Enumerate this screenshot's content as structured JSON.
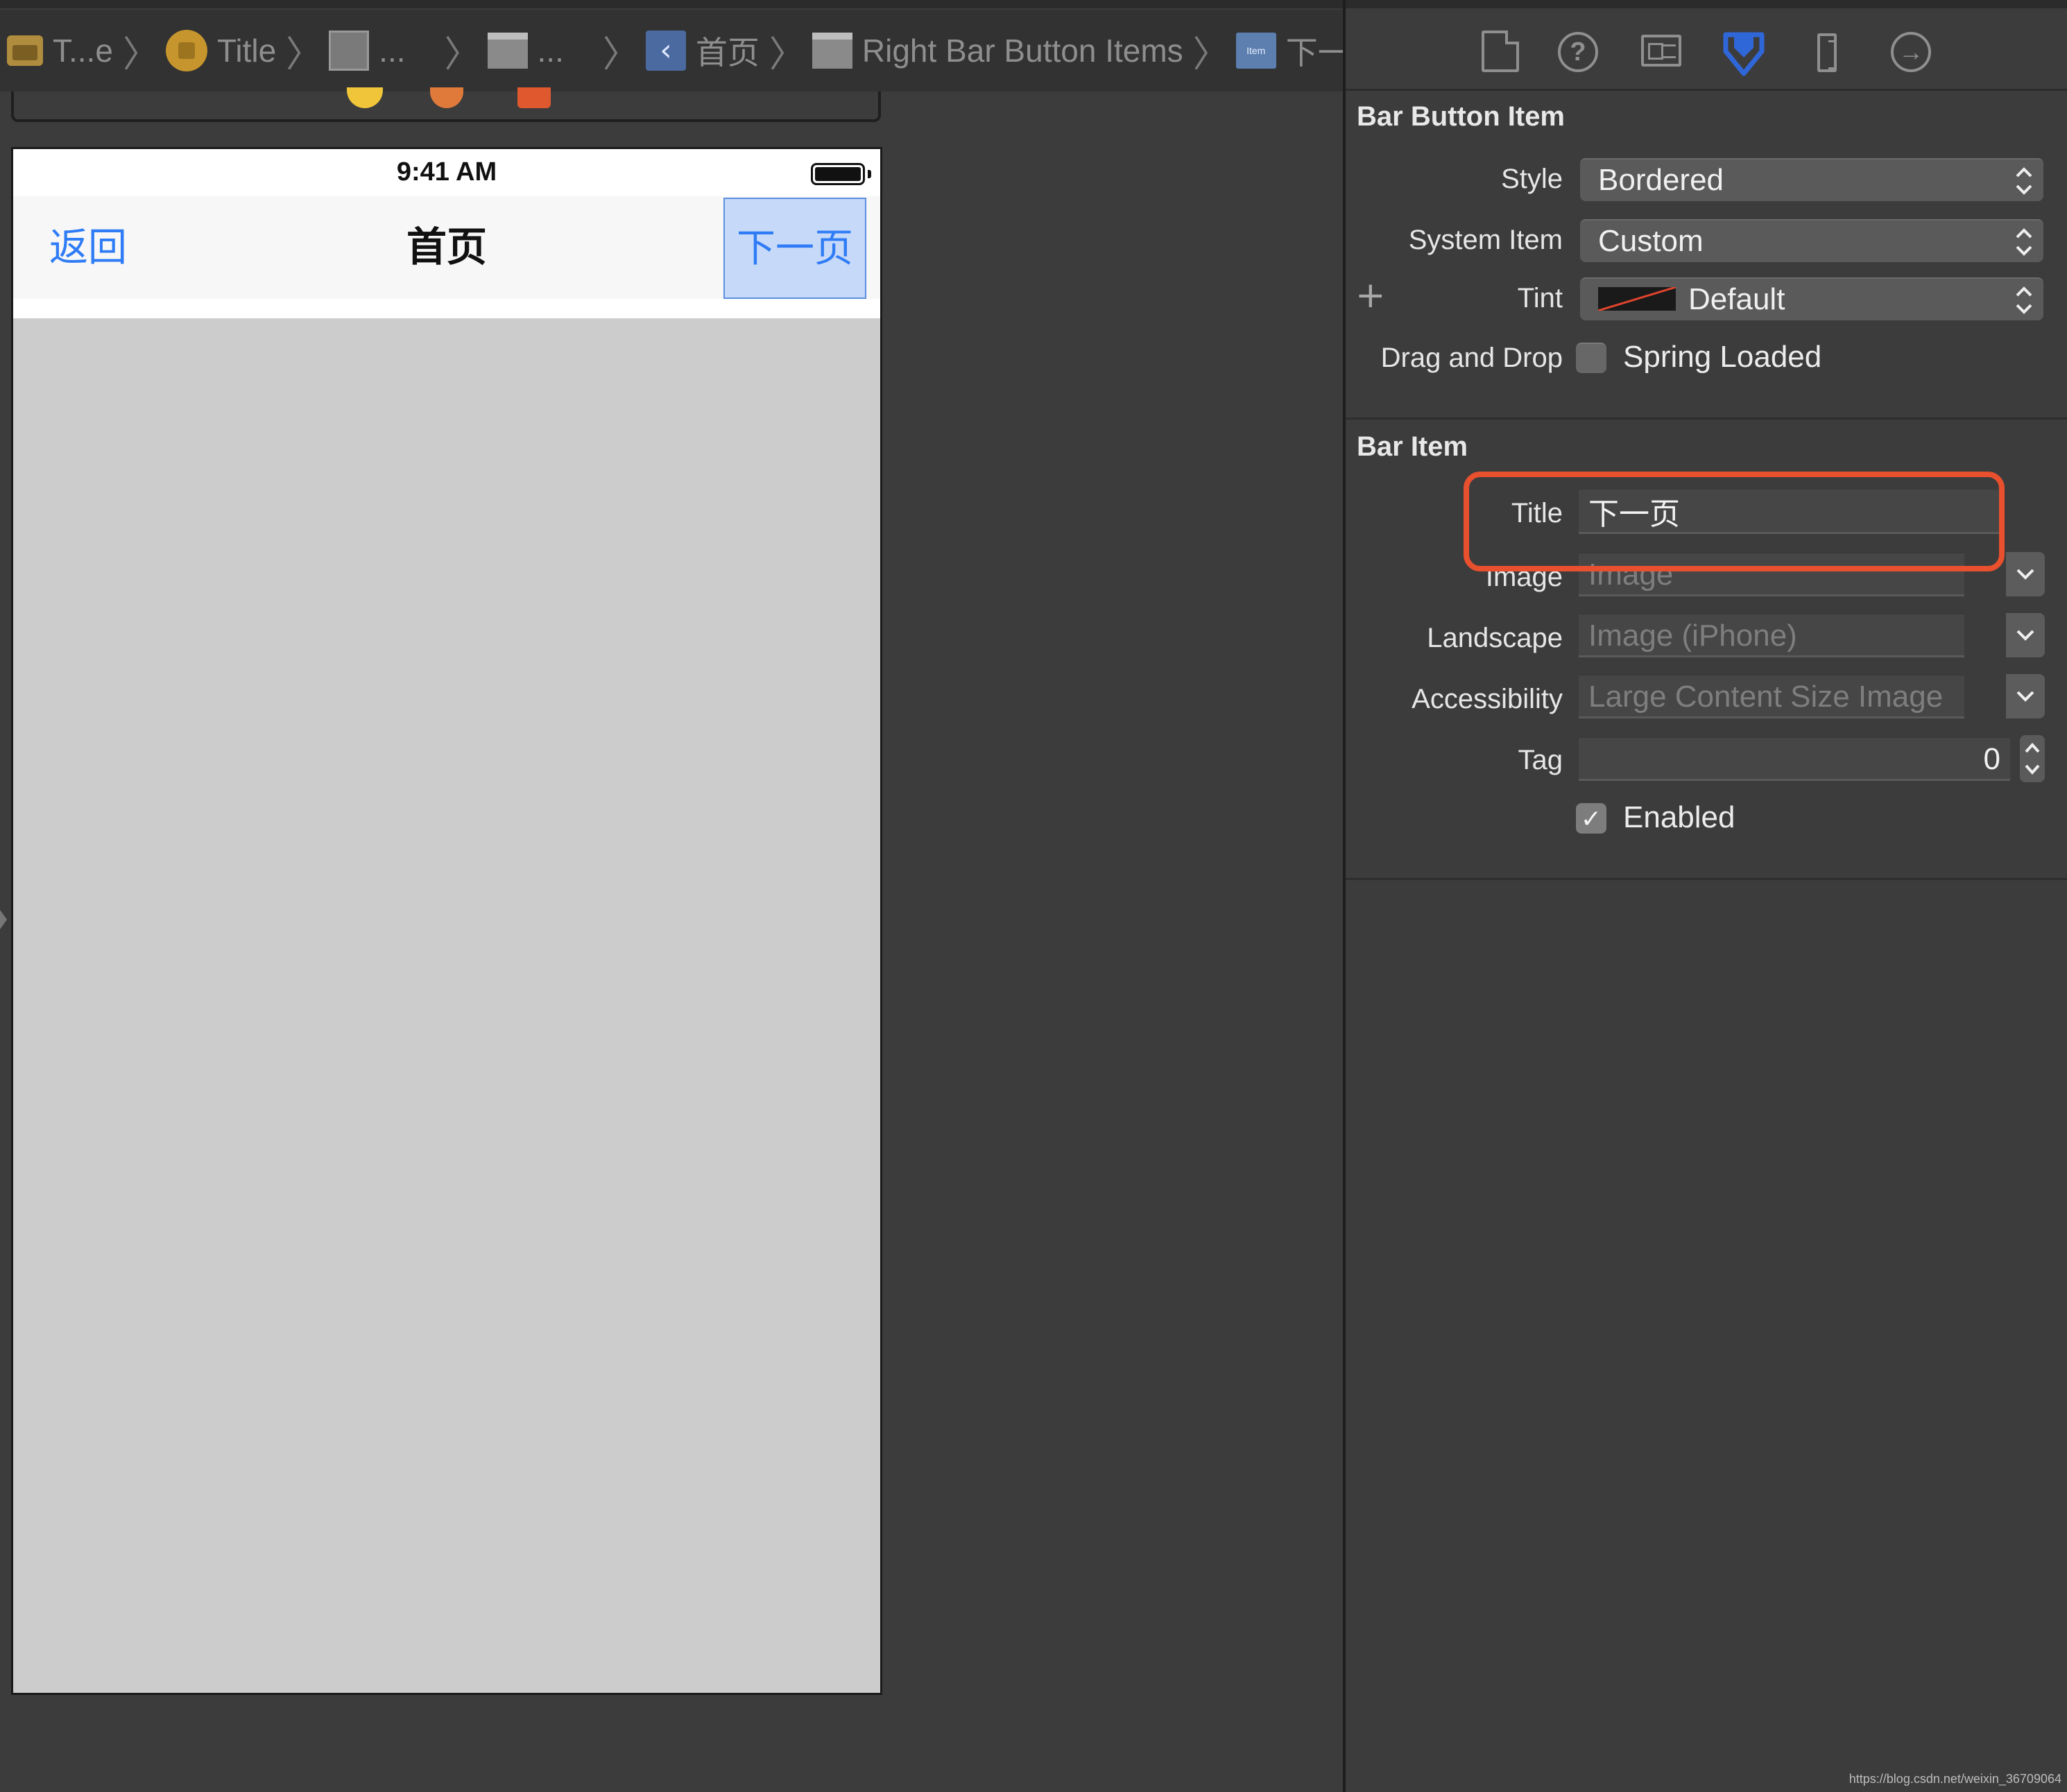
{
  "jumpbar": {
    "crumbs": [
      {
        "label": "T...e",
        "icon": "storyboard-icon"
      },
      {
        "label": "Title",
        "icon": "scene-icon"
      },
      {
        "label": "...",
        "icon": "view-controller-icon"
      },
      {
        "label": "...",
        "icon": "navigation-bar-icon"
      },
      {
        "label": "首页",
        "icon": "navigation-item-icon"
      },
      {
        "label": "Right Bar Button Items",
        "icon": "navigation-bar-icon"
      },
      {
        "label": "下一页",
        "icon": "bar-button-item-icon"
      }
    ],
    "bar_item_icon_text": "Item"
  },
  "device": {
    "status_time": "9:41 AM",
    "nav_back_label": "返回",
    "nav_title": "首页",
    "nav_right_label": "下一页"
  },
  "inspector": {
    "tabs": [
      "file-inspector-icon",
      "quick-help-icon",
      "identity-inspector-icon",
      "attributes-inspector-icon",
      "size-inspector-icon",
      "connections-inspector-icon"
    ],
    "active_tab": "attributes-inspector-icon",
    "bar_button_item": {
      "section_title": "Bar Button Item",
      "style_label": "Style",
      "style_value": "Bordered",
      "system_item_label": "System Item",
      "system_item_value": "Custom",
      "tint_label": "Tint",
      "tint_value": "Default",
      "drag_drop_label": "Drag and Drop",
      "spring_loaded_label": "Spring Loaded",
      "spring_loaded_checked": false
    },
    "bar_item": {
      "section_title": "Bar Item",
      "title_label": "Title",
      "title_value": "下一页",
      "image_label": "Image",
      "image_placeholder": "Image",
      "landscape_label": "Landscape",
      "landscape_placeholder": "Image (iPhone)",
      "accessibility_label": "Accessibility",
      "accessibility_placeholder": "Large Content Size Image",
      "tag_label": "Tag",
      "tag_value": "0",
      "enabled_label": "Enabled",
      "enabled_checked": true
    }
  },
  "colors": {
    "ios_tint": "#2f7cf6",
    "highlight": "#e8502e",
    "active_tab": "#2f66d8"
  },
  "watermark": "https://blog.csdn.net/weixin_36709064"
}
